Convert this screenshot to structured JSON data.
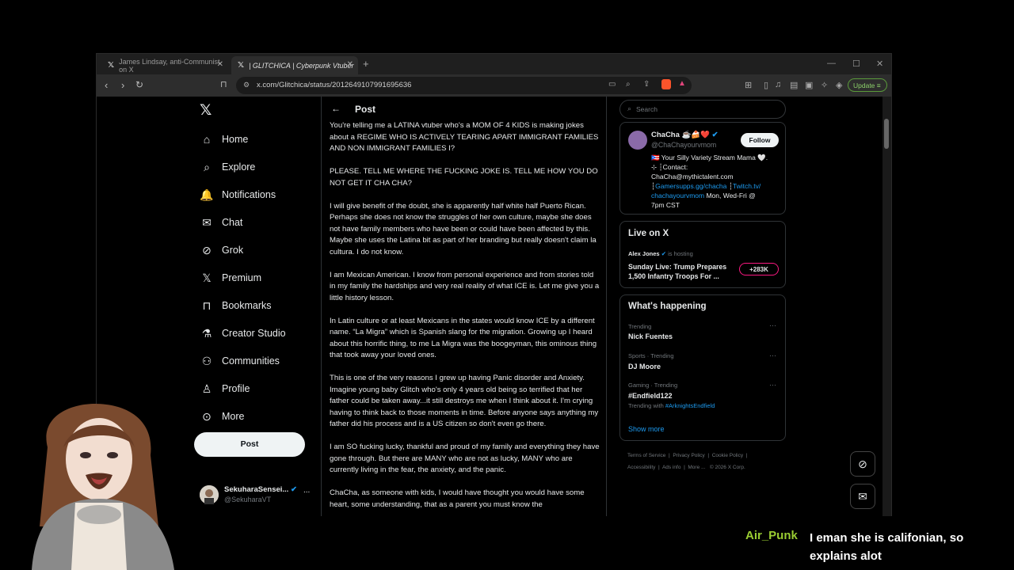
{
  "browser": {
    "tabs": [
      {
        "label": "James Lindsay, anti-Communist on X",
        "active": false
      },
      {
        "label": "| GLITCHICA | Cyberpunk Vtuber",
        "active": true
      }
    ],
    "new_tab": "+",
    "url": "x.com/Glitchica/status/2012649107991695636",
    "update_label": "Update"
  },
  "sidebar": {
    "items": [
      {
        "label": "Home",
        "icon": "home-icon"
      },
      {
        "label": "Explore",
        "icon": "search-icon"
      },
      {
        "label": "Notifications",
        "icon": "bell-icon"
      },
      {
        "label": "Chat",
        "icon": "mail-icon"
      },
      {
        "label": "Grok",
        "icon": "grok-icon"
      },
      {
        "label": "Premium",
        "icon": "x-icon"
      },
      {
        "label": "Bookmarks",
        "icon": "bookmark-icon"
      },
      {
        "label": "Creator Studio",
        "icon": "flask-icon"
      },
      {
        "label": "Communities",
        "icon": "people-icon"
      },
      {
        "label": "Profile",
        "icon": "person-icon"
      },
      {
        "label": "More",
        "icon": "more-circle-icon"
      }
    ],
    "post_label": "Post",
    "account": {
      "name": "SekuharaSensei...",
      "handle": "@SekuharaVT",
      "more": "..."
    }
  },
  "main": {
    "header": "Post",
    "paragraphs": [
      "You're telling me a LATINA vtuber who's a MOM OF 4 KIDS is making jokes about a REGIME WHO IS ACTIVELY TEARING APART IMMIGRANT FAMILIES AND NON IMMIGRANT FAMILIES I?",
      "PLEASE. TELL ME WHERE THE FUCKING JOKE IS. TELL ME HOW YOU DO NOT GET IT CHA CHA?",
      "I will give benefit of the doubt, she is apparently half white half Puerto Rican. Perhaps she does not know the struggles of her own culture, maybe she does not have family members who have been or could have been affected by this. Maybe she uses the Latina bit as part of her branding but really doesn't claim la cultura. I do not know.",
      "I am Mexican American. I know from personal experience and from stories told in my family the hardships and very real reality of what ICE is. Let me give you a little history lesson.",
      "In Latin culture or at least Mexicans in the states would know ICE by a different name. “La Migra” which is Spanish slang for the migration. Growing up I heard about this horrific thing, to me La Migra was the boogeyman, this ominous thing that took away your loved ones.",
      "This is one of the very reasons I grew up having Panic disorder and Anxiety. Imagine young baby Glitch who's only 4 years old being so terrified that her father could be taken away...it still destroys me when I think about it. I'm crying having to think back to those moments in time. Before anyone says anything my father did his process and is a US citizen so don't even go there.",
      "I am SO fucking lucky, thankful and proud of my family and everything they have gone through. But there are MANY who are not as lucky, MANY who are currently living in the fear, the anxiety, and the panic.",
      "ChaCha, as someone with kids, I would have thought you would have some heart, some understanding, that as a parent you must know the"
    ]
  },
  "right": {
    "search_placeholder": "Search",
    "profile": {
      "name": "ChaCha ☕🍰❤️",
      "handle": "@ChaChayourvmom",
      "follow_label": "Follow",
      "bio_1": "🇵🇷 Your Silly Variety Stream Mama 🤍.",
      "bio_2": "⊹ ┆Contact:",
      "bio_3": "ChaCha@mythictalent.com",
      "bio_4a": "┆",
      "bio_4b": "Gamersupps.gg/chacha",
      "bio_4c": " ┆",
      "bio_4d": "Twitch.tv/",
      "bio_5a": "chachayourvmom",
      "bio_5b": " Mon, Wed-Fri @",
      "bio_6": "7pm CST"
    },
    "live": {
      "title": "Live on X",
      "host_name": "Alex Jones",
      "host_suffix": " is hosting",
      "text": "Sunday Live: Trump Prepares 1,500 Infantry Troops For ...",
      "count": "+283K"
    },
    "trends": {
      "title": "What's happening",
      "items": [
        {
          "sub": "Trending",
          "name": "Nick Fuentes"
        },
        {
          "sub": "Sports · Trending",
          "name": "DJ Moore"
        },
        {
          "sub": "Gaming · Trending",
          "name": "#Endfield122",
          "extra_prefix": "Trending with ",
          "extra_link": "#ArknightsEndfield"
        }
      ],
      "show_more": "Show more"
    },
    "footer": {
      "line1": [
        "Terms of Service",
        "Privacy Policy",
        "Cookie Policy"
      ],
      "line2": [
        "Accessibility",
        "Ads info",
        "More ...",
        "© 2026 X Corp."
      ]
    }
  },
  "chat": {
    "user": "Air_Punk",
    "message": "I eman she is califonian, so explains alot"
  },
  "colors": {
    "accent": "#1d9bf0",
    "chat_user": "#9acd32",
    "live": "#f91880"
  }
}
